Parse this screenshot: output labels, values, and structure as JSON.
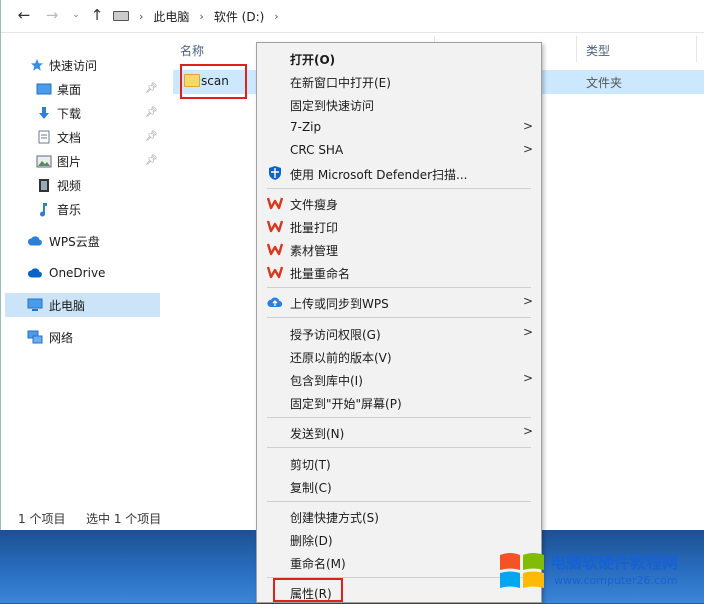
{
  "breadcrumb": {
    "items": [
      "此电脑",
      "软件 (D:)"
    ]
  },
  "sidebar": {
    "items": [
      {
        "label": "快速访问"
      },
      {
        "label": "桌面"
      },
      {
        "label": "下载"
      },
      {
        "label": "文档"
      },
      {
        "label": "图片"
      },
      {
        "label": "视频"
      },
      {
        "label": "音乐"
      },
      {
        "label": "WPS云盘"
      },
      {
        "label": "OneDrive"
      },
      {
        "label": "此电脑"
      },
      {
        "label": "网络"
      }
    ]
  },
  "columns": {
    "name": "名称",
    "type": "类型"
  },
  "file": {
    "name": "scan",
    "type": "文件夹"
  },
  "status": {
    "count": "1 个项目",
    "selected": "选中 1 个项目"
  },
  "menu": {
    "items": [
      "打开(O)",
      "在新窗口中打开(E)",
      "固定到快速访问",
      "7-Zip",
      "CRC SHA",
      "使用 Microsoft Defender扫描...",
      "文件瘦身",
      "批量打印",
      "素材管理",
      "批量重命名",
      "上传或同步到WPS",
      "授予访问权限(G)",
      "还原以前的版本(V)",
      "包含到库中(I)",
      "固定到\"开始\"屏幕(P)",
      "发送到(N)",
      "剪切(T)",
      "复制(C)",
      "创建快捷方式(S)",
      "删除(D)",
      "重命名(M)",
      "属性(R)"
    ]
  },
  "watermark": {
    "title": "电脑软硬件教程网",
    "url": "www.computer26.com"
  },
  "colors": {
    "accent": "#1662d4",
    "highlight": "#cce8ff",
    "annotation_red": "#e0201a",
    "wps_red": "#d9381e"
  }
}
